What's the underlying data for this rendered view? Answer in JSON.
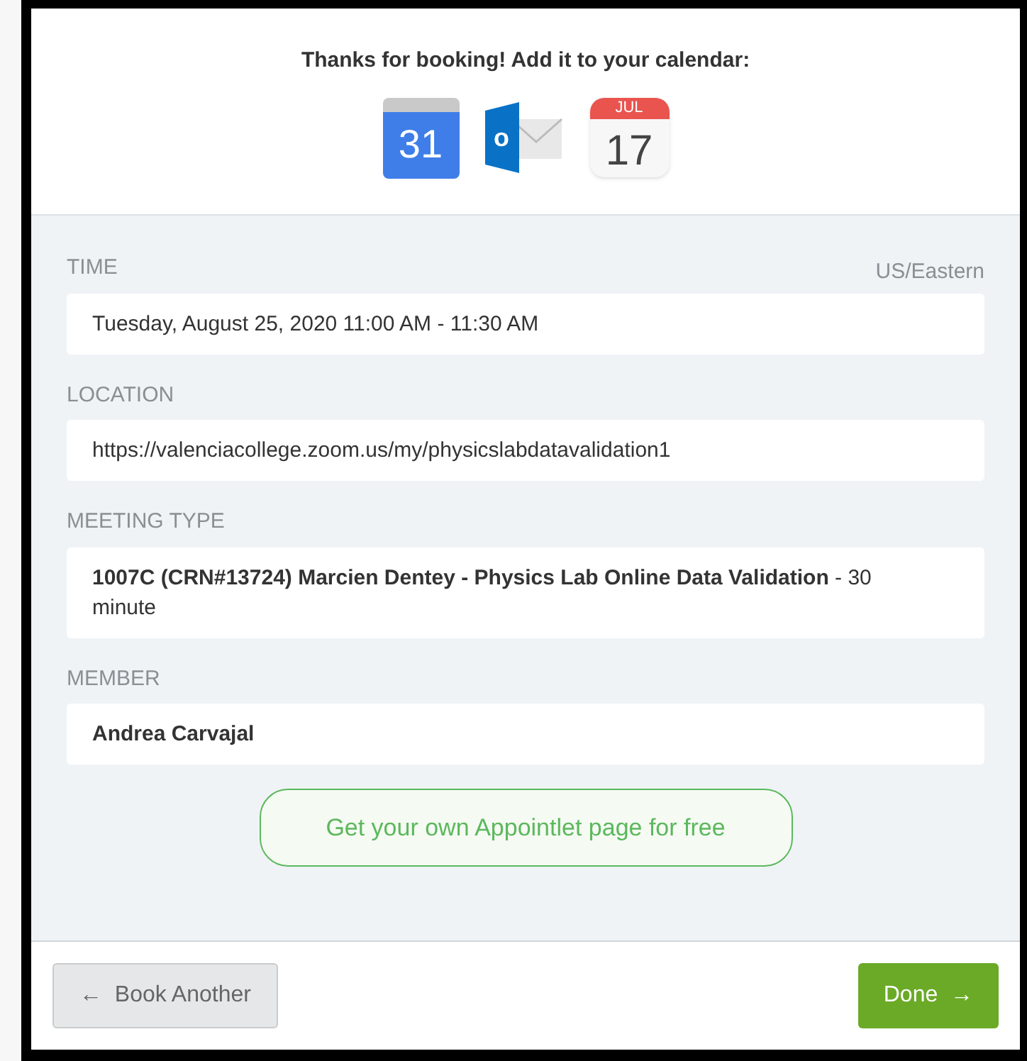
{
  "header": {
    "title": "Thanks for booking! Add it to your calendar:",
    "calendar_icons": [
      {
        "kind": "google",
        "text": "31"
      },
      {
        "kind": "outlook",
        "text": "o"
      },
      {
        "kind": "apple",
        "month": "JUL",
        "text": "17"
      }
    ]
  },
  "timezone": "US/Eastern",
  "fields": [
    {
      "label": "TIME",
      "value": "Tuesday, August 25, 2020 11:00 AM - 11:30 AM",
      "bold": false
    },
    {
      "label": "LOCATION",
      "value": "https://valenciacollege.zoom.us/my/physicslabdatavalidation1",
      "bold": false
    },
    {
      "label": "MEETING TYPE",
      "value": "**1007C (CRN#13724) Marcien Dentey - Physics Lab Online Data Validation** - 30 minute",
      "bold": false
    },
    {
      "label": "MEMBER",
      "value": "Andrea Carvajal",
      "bold": true
    }
  ],
  "promo_link": "Get your own Appointlet page for free",
  "footer": {
    "back_arrow": "←",
    "back_label": "Book Another",
    "done_label": "Done",
    "done_arrow": "→"
  }
}
